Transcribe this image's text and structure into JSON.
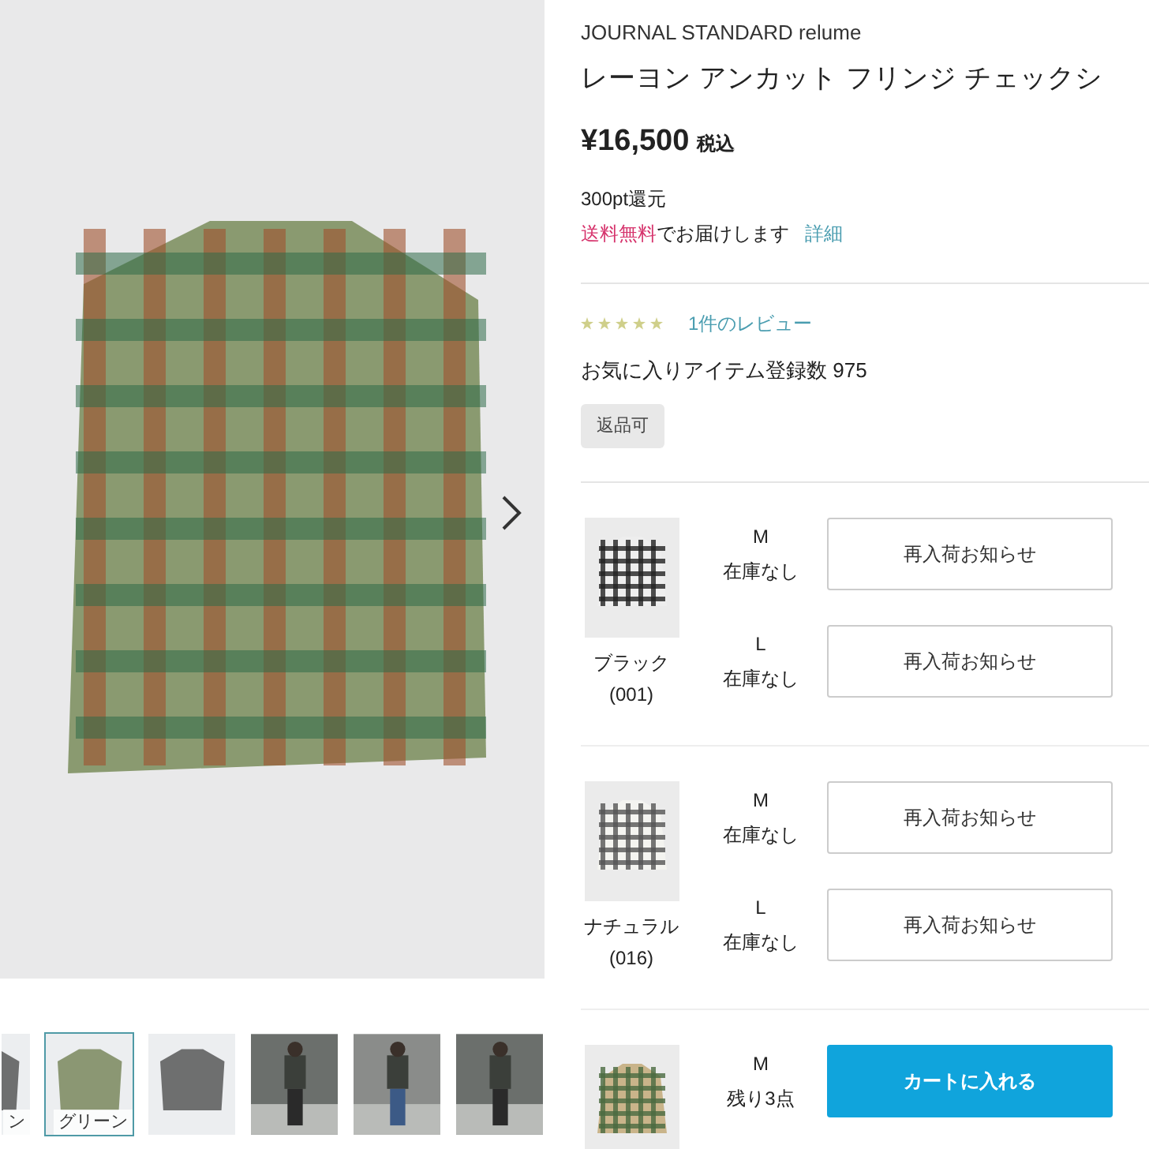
{
  "gallery": {
    "thumbnails": [
      {
        "label": "ン",
        "selected": false,
        "kind": "flat"
      },
      {
        "label": "グリーン",
        "selected": true,
        "kind": "flat"
      },
      {
        "selected": false,
        "kind": "flat"
      },
      {
        "selected": false,
        "kind": "photo"
      },
      {
        "selected": false,
        "kind": "photo"
      },
      {
        "selected": false,
        "kind": "photo"
      }
    ]
  },
  "product": {
    "brand": "JOURNAL STANDARD relume",
    "title": "レーヨン アンカット フリンジ チェックシ",
    "price": "¥16,500",
    "tax": "税込",
    "points": "300pt還元",
    "shipping_highlight": "送料無料",
    "shipping_text": "でお届けします",
    "shipping_link": "詳細",
    "stars": 5,
    "reviews": "1件のレビュー",
    "favorites": "お気に入りアイテム登録数 975",
    "tag": "返品可"
  },
  "variants": [
    {
      "name": "ブラック",
      "code": "(001)",
      "kind": "dark",
      "sizes": [
        {
          "size": "M",
          "stock": "在庫なし",
          "kind": "notify",
          "button": "再入荷お知らせ"
        },
        {
          "size": "L",
          "stock": "在庫なし",
          "kind": "notify",
          "button": "再入荷お知らせ"
        }
      ]
    },
    {
      "name": "ナチュラル",
      "code": "(016)",
      "kind": "light",
      "sizes": [
        {
          "size": "M",
          "stock": "在庫なし",
          "kind": "notify",
          "button": "再入荷お知らせ"
        },
        {
          "size": "L",
          "stock": "在庫なし",
          "kind": "notify",
          "button": "再入荷お知らせ"
        }
      ]
    },
    {
      "kind": "green",
      "sizes": [
        {
          "size": "M",
          "stock": "残り3点",
          "kind": "cart",
          "button": "カートに入れる"
        }
      ]
    }
  ]
}
